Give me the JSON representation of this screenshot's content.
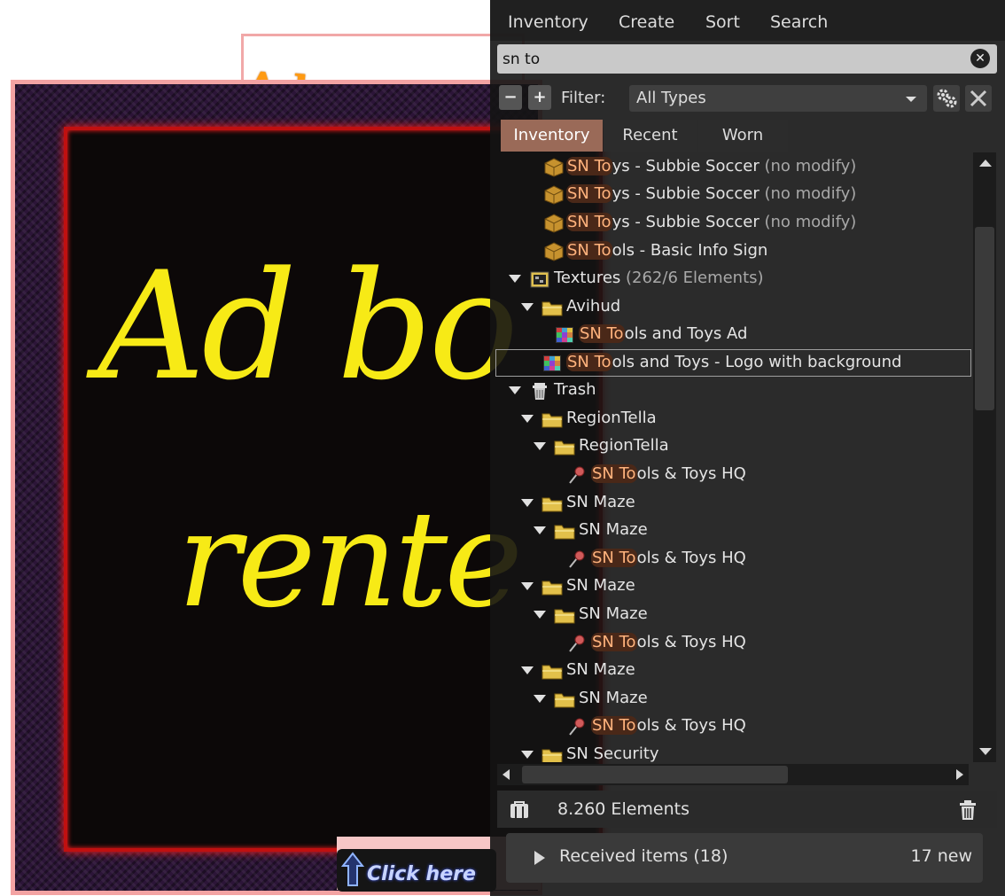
{
  "background": {
    "sign_top_text": "Advertis",
    "board_line1": "Ad bo",
    "board_line2": "rente",
    "click_text": "Click here"
  },
  "menu": [
    {
      "label": "Inventory"
    },
    {
      "label": "Create"
    },
    {
      "label": "Sort"
    },
    {
      "label": "Search"
    }
  ],
  "search": {
    "value": "sn to"
  },
  "filter": {
    "label": "Filter:",
    "value": "All Types"
  },
  "tabs": [
    {
      "label": "Inventory",
      "active": true
    },
    {
      "label": "Recent",
      "active": false
    },
    {
      "label": "Worn",
      "active": false
    }
  ],
  "tree": [
    {
      "icon": "object-box-icon",
      "match": "SN To",
      "rest": "ys - Subbie Soccer",
      "suffix": " (no modify)"
    },
    {
      "icon": "object-box-icon",
      "match": "SN To",
      "rest": "ys - Subbie Soccer",
      "suffix": " (no modify)"
    },
    {
      "icon": "object-box-icon",
      "match": "SN To",
      "rest": "ys - Subbie Soccer",
      "suffix": " (no modify)"
    },
    {
      "icon": "object-box-icon",
      "match": "SN To",
      "rest": "ols - Basic Info Sign",
      "suffix": ""
    },
    {
      "icon": "texture-folder-icon",
      "text": "Textures",
      "suffix": " (262/6 Elements)"
    },
    {
      "icon": "folder-icon",
      "text": "Avihud",
      "suffix": ""
    },
    {
      "icon": "texture-icon",
      "match": "SN To",
      "rest": "ols and Toys Ad",
      "suffix": ""
    },
    {
      "icon": "texture-icon",
      "match": "SN To",
      "rest": "ols and Toys - Logo with background",
      "suffix": ""
    },
    {
      "icon": "trash-folder-icon",
      "text": "Trash",
      "suffix": ""
    },
    {
      "icon": "folder-icon",
      "text": "RegionTella",
      "suffix": ""
    },
    {
      "icon": "folder-icon",
      "text": "RegionTella",
      "suffix": ""
    },
    {
      "icon": "landmark-icon",
      "match": "SN To",
      "rest": "ols & Toys HQ",
      "suffix": ""
    },
    {
      "icon": "folder-icon",
      "text": "SN Maze",
      "suffix": ""
    },
    {
      "icon": "folder-icon",
      "text": "SN Maze",
      "suffix": ""
    },
    {
      "icon": "landmark-icon",
      "match": "SN To",
      "rest": "ols & Toys HQ",
      "suffix": ""
    },
    {
      "icon": "folder-icon",
      "text": "SN Maze",
      "suffix": ""
    },
    {
      "icon": "folder-icon",
      "text": "SN Maze",
      "suffix": ""
    },
    {
      "icon": "landmark-icon",
      "match": "SN To",
      "rest": "ols & Toys HQ",
      "suffix": ""
    },
    {
      "icon": "folder-icon",
      "text": "SN Maze",
      "suffix": ""
    },
    {
      "icon": "folder-icon",
      "text": "SN Maze",
      "suffix": ""
    },
    {
      "icon": "landmark-icon",
      "match": "SN To",
      "rest": "ols & Toys HQ",
      "suffix": ""
    },
    {
      "icon": "folder-icon",
      "text": "SN Security",
      "suffix": ""
    }
  ],
  "status": {
    "count_text": "8.260 Elements"
  },
  "received": {
    "label": "Received items (18)",
    "new_count": "17 new"
  },
  "colors": {
    "match_highlight": "#ffb37d",
    "active_tab": "#9a6a58",
    "board_text": "#f7ea16"
  }
}
